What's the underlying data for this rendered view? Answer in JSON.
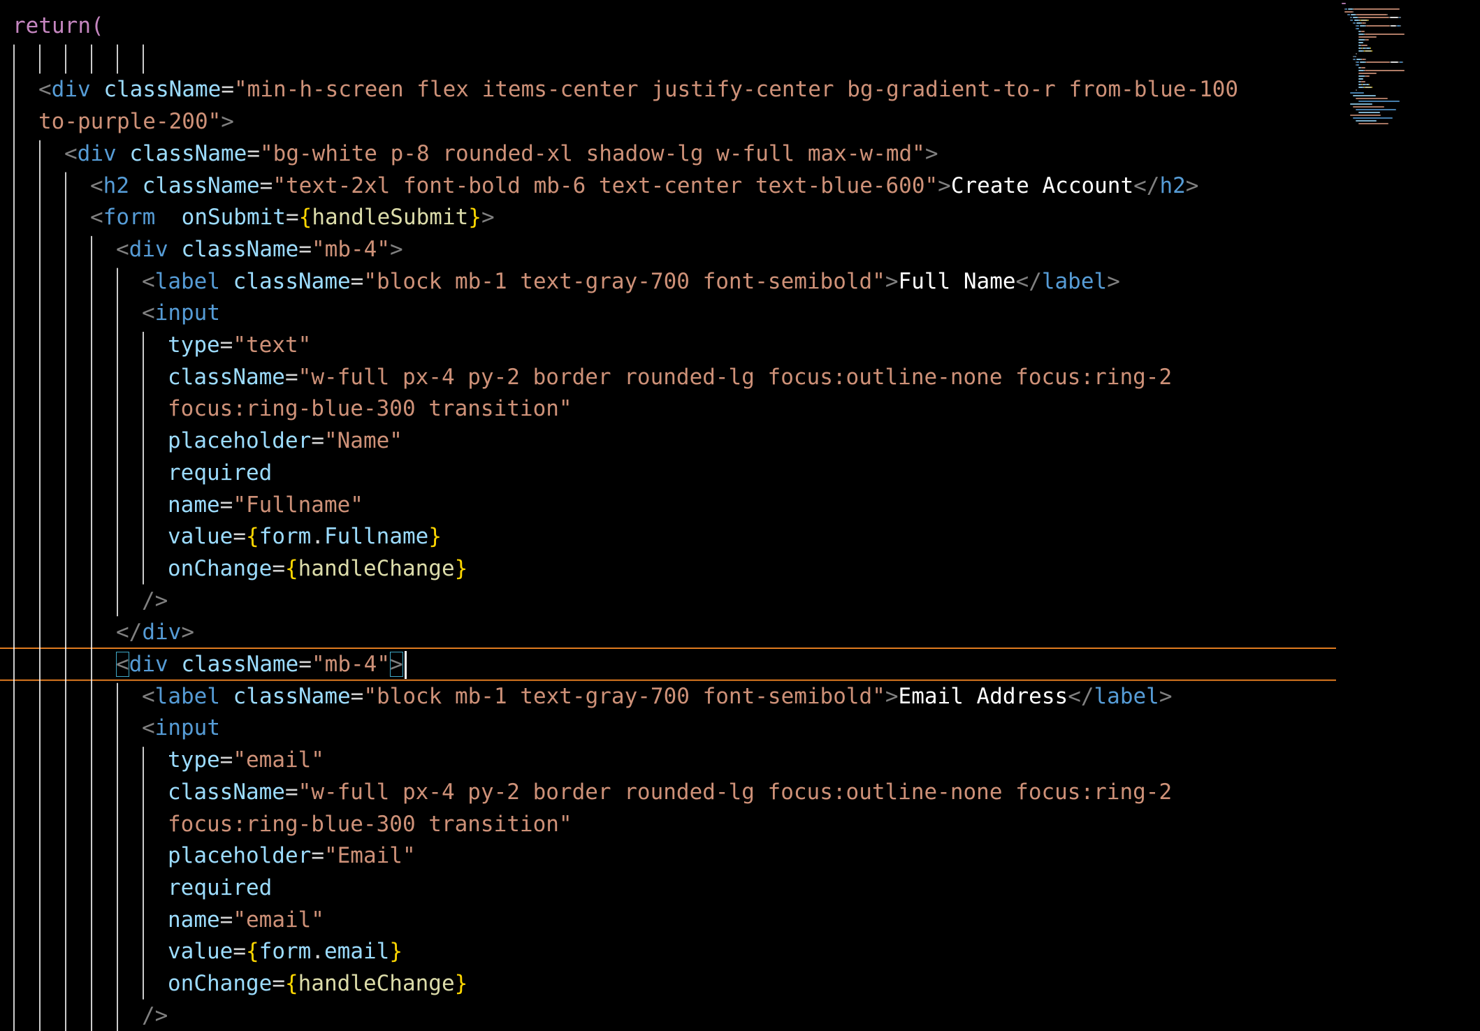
{
  "editor": {
    "language": "jsx",
    "colors": {
      "background": "#000000",
      "keyword": "#c586c0",
      "tag": "#569cd6",
      "attribute": "#9cdcfe",
      "string": "#ce9178",
      "text": "#ffffff",
      "function": "#dcdcaa",
      "brace": "#ffd700",
      "indent_guide": "#ffffff",
      "current_line_border": "#e07b20",
      "bracket_match": "#3fa9c8"
    },
    "current_line_index": 20,
    "lines": [
      {
        "indent": 0,
        "tokens": [
          {
            "c": "kw",
            "t": "return("
          }
        ]
      },
      {
        "indent": 0,
        "tokens": []
      },
      {
        "indent": 1,
        "tokens": [
          {
            "c": "punct",
            "t": "<"
          },
          {
            "c": "tag",
            "t": "div"
          },
          {
            "c": "plain",
            "t": " "
          },
          {
            "c": "attr",
            "t": "className"
          },
          {
            "c": "plain",
            "t": "="
          },
          {
            "c": "str",
            "t": "\"min-h-screen flex items-center justify-center bg-gradient-to-r from-blue-100"
          }
        ]
      },
      {
        "indent": 1,
        "tokens": [
          {
            "c": "str",
            "t": "to-purple-200\""
          },
          {
            "c": "punct",
            "t": ">"
          }
        ]
      },
      {
        "indent": 2,
        "tokens": [
          {
            "c": "punct",
            "t": "<"
          },
          {
            "c": "tag",
            "t": "div"
          },
          {
            "c": "plain",
            "t": " "
          },
          {
            "c": "attr",
            "t": "className"
          },
          {
            "c": "plain",
            "t": "="
          },
          {
            "c": "str",
            "t": "\"bg-white p-8 rounded-xl shadow-lg w-full max-w-md\""
          },
          {
            "c": "punct",
            "t": ">"
          }
        ]
      },
      {
        "indent": 3,
        "tokens": [
          {
            "c": "punct",
            "t": "<"
          },
          {
            "c": "tag",
            "t": "h2"
          },
          {
            "c": "plain",
            "t": " "
          },
          {
            "c": "attr",
            "t": "className"
          },
          {
            "c": "plain",
            "t": "="
          },
          {
            "c": "str",
            "t": "\"text-2xl font-bold mb-6 text-center text-blue-600\""
          },
          {
            "c": "punct",
            "t": ">"
          },
          {
            "c": "text",
            "t": "Create Account"
          },
          {
            "c": "punct",
            "t": "</"
          },
          {
            "c": "tag",
            "t": "h2"
          },
          {
            "c": "punct",
            "t": ">"
          }
        ]
      },
      {
        "indent": 3,
        "tokens": [
          {
            "c": "punct",
            "t": "<"
          },
          {
            "c": "tag",
            "t": "form"
          },
          {
            "c": "plain",
            "t": "  "
          },
          {
            "c": "attr",
            "t": "onSubmit"
          },
          {
            "c": "plain",
            "t": "="
          },
          {
            "c": "brace",
            "t": "{"
          },
          {
            "c": "fn",
            "t": "handleSubmit"
          },
          {
            "c": "brace",
            "t": "}"
          },
          {
            "c": "punct",
            "t": ">"
          }
        ]
      },
      {
        "indent": 4,
        "tokens": [
          {
            "c": "punct",
            "t": "<"
          },
          {
            "c": "tag",
            "t": "div"
          },
          {
            "c": "plain",
            "t": " "
          },
          {
            "c": "attr",
            "t": "className"
          },
          {
            "c": "plain",
            "t": "="
          },
          {
            "c": "str",
            "t": "\"mb-4\""
          },
          {
            "c": "punct",
            "t": ">"
          }
        ]
      },
      {
        "indent": 5,
        "tokens": [
          {
            "c": "punct",
            "t": "<"
          },
          {
            "c": "tag",
            "t": "label"
          },
          {
            "c": "plain",
            "t": " "
          },
          {
            "c": "attr",
            "t": "className"
          },
          {
            "c": "plain",
            "t": "="
          },
          {
            "c": "str",
            "t": "\"block mb-1 text-gray-700 font-semibold\""
          },
          {
            "c": "punct",
            "t": ">"
          },
          {
            "c": "text",
            "t": "Full Name"
          },
          {
            "c": "punct",
            "t": "</"
          },
          {
            "c": "tag",
            "t": "label"
          },
          {
            "c": "punct",
            "t": ">"
          }
        ]
      },
      {
        "indent": 5,
        "tokens": [
          {
            "c": "punct",
            "t": "<"
          },
          {
            "c": "tag",
            "t": "input"
          }
        ]
      },
      {
        "indent": 6,
        "tokens": [
          {
            "c": "attr",
            "t": "type"
          },
          {
            "c": "plain",
            "t": "="
          },
          {
            "c": "str",
            "t": "\"text\""
          }
        ]
      },
      {
        "indent": 6,
        "tokens": [
          {
            "c": "attr",
            "t": "className"
          },
          {
            "c": "plain",
            "t": "="
          },
          {
            "c": "str",
            "t": "\"w-full px-4 py-2 border rounded-lg focus:outline-none focus:ring-2"
          }
        ]
      },
      {
        "indent": 6,
        "tokens": [
          {
            "c": "str",
            "t": "focus:ring-blue-300 transition\""
          }
        ]
      },
      {
        "indent": 6,
        "tokens": [
          {
            "c": "attr",
            "t": "placeholder"
          },
          {
            "c": "plain",
            "t": "="
          },
          {
            "c": "str",
            "t": "\"Name\""
          }
        ]
      },
      {
        "indent": 6,
        "tokens": [
          {
            "c": "attr",
            "t": "required"
          }
        ]
      },
      {
        "indent": 6,
        "tokens": [
          {
            "c": "attr",
            "t": "name"
          },
          {
            "c": "plain",
            "t": "="
          },
          {
            "c": "str",
            "t": "\"Fullname\""
          }
        ]
      },
      {
        "indent": 6,
        "tokens": [
          {
            "c": "attr",
            "t": "value"
          },
          {
            "c": "plain",
            "t": "="
          },
          {
            "c": "brace",
            "t": "{"
          },
          {
            "c": "attr",
            "t": "form"
          },
          {
            "c": "plain",
            "t": "."
          },
          {
            "c": "attr",
            "t": "Fullname"
          },
          {
            "c": "brace",
            "t": "}"
          }
        ]
      },
      {
        "indent": 6,
        "tokens": [
          {
            "c": "attr",
            "t": "onChange"
          },
          {
            "c": "plain",
            "t": "="
          },
          {
            "c": "brace",
            "t": "{"
          },
          {
            "c": "fn",
            "t": "handleChange"
          },
          {
            "c": "brace",
            "t": "}"
          }
        ]
      },
      {
        "indent": 5,
        "tokens": [
          {
            "c": "punct",
            "t": "/>"
          }
        ]
      },
      {
        "indent": 4,
        "tokens": [
          {
            "c": "punct",
            "t": "</"
          },
          {
            "c": "tag",
            "t": "div"
          },
          {
            "c": "punct",
            "t": ">"
          }
        ]
      },
      {
        "indent": 4,
        "tokens": [
          {
            "c": "punct",
            "t": "<",
            "m": 1
          },
          {
            "c": "tag",
            "t": "div"
          },
          {
            "c": "plain",
            "t": " "
          },
          {
            "c": "attr",
            "t": "className"
          },
          {
            "c": "plain",
            "t": "="
          },
          {
            "c": "str",
            "t": "\"mb-4\""
          },
          {
            "c": "punct",
            "t": ">",
            "m": 1
          }
        ]
      },
      {
        "indent": 5,
        "tokens": [
          {
            "c": "punct",
            "t": "<"
          },
          {
            "c": "tag",
            "t": "label"
          },
          {
            "c": "plain",
            "t": " "
          },
          {
            "c": "attr",
            "t": "className"
          },
          {
            "c": "plain",
            "t": "="
          },
          {
            "c": "str",
            "t": "\"block mb-1 text-gray-700 font-semibold\""
          },
          {
            "c": "punct",
            "t": ">"
          },
          {
            "c": "text",
            "t": "Email Address"
          },
          {
            "c": "punct",
            "t": "</"
          },
          {
            "c": "tag",
            "t": "label"
          },
          {
            "c": "punct",
            "t": ">"
          }
        ]
      },
      {
        "indent": 5,
        "tokens": [
          {
            "c": "punct",
            "t": "<"
          },
          {
            "c": "tag",
            "t": "input"
          }
        ]
      },
      {
        "indent": 6,
        "tokens": [
          {
            "c": "attr",
            "t": "type"
          },
          {
            "c": "plain",
            "t": "="
          },
          {
            "c": "str",
            "t": "\"email\""
          }
        ]
      },
      {
        "indent": 6,
        "tokens": [
          {
            "c": "attr",
            "t": "className"
          },
          {
            "c": "plain",
            "t": "="
          },
          {
            "c": "str",
            "t": "\"w-full px-4 py-2 border rounded-lg focus:outline-none focus:ring-2"
          }
        ]
      },
      {
        "indent": 6,
        "tokens": [
          {
            "c": "str",
            "t": "focus:ring-blue-300 transition\""
          }
        ]
      },
      {
        "indent": 6,
        "tokens": [
          {
            "c": "attr",
            "t": "placeholder"
          },
          {
            "c": "plain",
            "t": "="
          },
          {
            "c": "str",
            "t": "\"Email\""
          }
        ]
      },
      {
        "indent": 6,
        "tokens": [
          {
            "c": "attr",
            "t": "required"
          }
        ]
      },
      {
        "indent": 6,
        "tokens": [
          {
            "c": "attr",
            "t": "name"
          },
          {
            "c": "plain",
            "t": "="
          },
          {
            "c": "str",
            "t": "\"email\""
          }
        ]
      },
      {
        "indent": 6,
        "tokens": [
          {
            "c": "attr",
            "t": "value"
          },
          {
            "c": "plain",
            "t": "="
          },
          {
            "c": "brace",
            "t": "{"
          },
          {
            "c": "attr",
            "t": "form"
          },
          {
            "c": "plain",
            "t": "."
          },
          {
            "c": "attr",
            "t": "email"
          },
          {
            "c": "brace",
            "t": "}"
          }
        ]
      },
      {
        "indent": 6,
        "tokens": [
          {
            "c": "attr",
            "t": "onChange"
          },
          {
            "c": "plain",
            "t": "="
          },
          {
            "c": "brace",
            "t": "{"
          },
          {
            "c": "fn",
            "t": "handleChange"
          },
          {
            "c": "brace",
            "t": "}"
          }
        ]
      },
      {
        "indent": 5,
        "tokens": [
          {
            "c": "punct",
            "t": "/>"
          }
        ]
      }
    ]
  },
  "minimap": {
    "label": "minimap"
  }
}
